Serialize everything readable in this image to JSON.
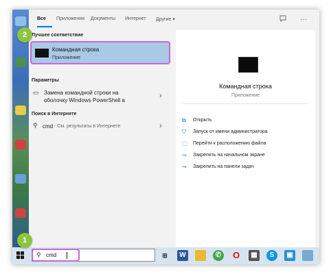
{
  "tabs": [
    "Все",
    "Приложения",
    "Документы",
    "Интернет",
    "Другие ▾"
  ],
  "tabs_right": {
    "feedback_icon": "feedback-icon",
    "more_icon": "more-icon",
    "more_glyph": "···"
  },
  "sections": {
    "best_match": "Лучшее соответствие",
    "settings": "Параметры",
    "web": "Поиск в Интернете"
  },
  "best_match": {
    "title": "Командная строка",
    "subtitle": "Приложение"
  },
  "settings_item": {
    "line1": "Замена командной строки на",
    "line2": "оболочку Windows PowerShell в"
  },
  "web_item": {
    "query": "cmd",
    "hint": "- См. результаты в Интернете"
  },
  "detail": {
    "title": "Командная строка",
    "subtitle": "Приложение",
    "actions": [
      "Открыть",
      "Запуск от имени администратора",
      "Перейти к расположению файла",
      "Закрепить на начальном экране",
      "Закрепить на панели задач"
    ]
  },
  "badges": {
    "step1": "1",
    "step2": "2"
  },
  "taskbar": {
    "search_value": "cmd",
    "apps": [
      "task-view",
      "word",
      "file-explorer",
      "whatsapp",
      "opera",
      "calculator",
      "skype",
      "photos",
      "store"
    ]
  },
  "colors": {
    "highlight": "#c867d5",
    "selected": "#a9c9e6",
    "badge": "#8cc63f",
    "accent": "#0078d7"
  }
}
